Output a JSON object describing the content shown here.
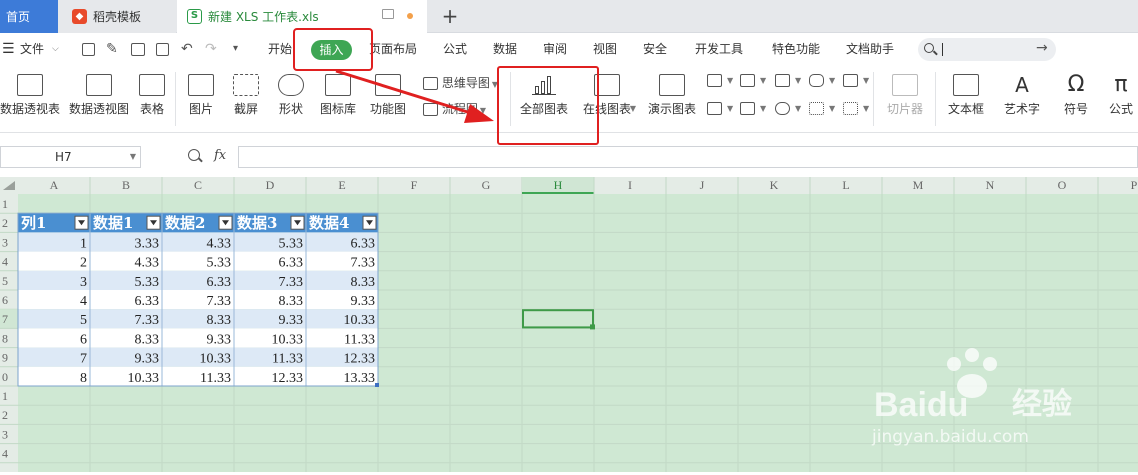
{
  "tabs": {
    "home": "首页",
    "templates": "稻壳模板",
    "templates_icon": "docer-icon",
    "doc": "新建 XLS 工作表.xls",
    "new": "+"
  },
  "menu": {
    "file": "文件",
    "items": [
      "开始",
      "插入",
      "页面布局",
      "公式",
      "数据",
      "审阅",
      "视图",
      "安全",
      "开发工具",
      "特色功能",
      "文档助手"
    ],
    "active": "插入"
  },
  "ribbon": {
    "large": [
      "数据透视表",
      "数据透视图",
      "表格",
      "图片",
      "截屏",
      "形状",
      "图标库",
      "功能图",
      "全部图表",
      "在线图表",
      "演示图表",
      "切片器",
      "文本框",
      "艺术字",
      "符号",
      "公式"
    ],
    "small": [
      "思维导图",
      "流程图"
    ]
  },
  "formula": {
    "cell": "H7",
    "fx": "fx",
    "value": ""
  },
  "sheet": {
    "columns": [
      "A",
      "B",
      "C",
      "D",
      "E",
      "F",
      "G",
      "H",
      "I",
      "J",
      "K",
      "L",
      "M",
      "N",
      "O",
      "P"
    ],
    "rows": [
      "1",
      "2",
      "3",
      "4",
      "5",
      "6",
      "7",
      "8",
      "9",
      "0",
      "1",
      "2",
      "3",
      "4"
    ],
    "selected_col": "H",
    "selected_row": "7",
    "header": [
      "列1",
      "数据1",
      "数据2",
      "数据3",
      "数据4"
    ],
    "data": [
      [
        "1",
        "3.33",
        "4.33",
        "5.33",
        "6.33"
      ],
      [
        "2",
        "4.33",
        "5.33",
        "6.33",
        "7.33"
      ],
      [
        "3",
        "5.33",
        "6.33",
        "7.33",
        "8.33"
      ],
      [
        "4",
        "6.33",
        "7.33",
        "8.33",
        "9.33"
      ],
      [
        "5",
        "7.33",
        "8.33",
        "9.33",
        "10.33"
      ],
      [
        "6",
        "8.33",
        "9.33",
        "10.33",
        "11.33"
      ],
      [
        "7",
        "9.33",
        "10.33",
        "11.33",
        "12.33"
      ],
      [
        "8",
        "10.33",
        "11.33",
        "12.33",
        "13.33"
      ]
    ]
  },
  "watermark": {
    "brand": "Baidu",
    "brand2": "经验",
    "url": "jingyan.baidu.com"
  },
  "colors": {
    "grid_bg": "#cfe8d3",
    "header_blue": "#4a8fd1",
    "band_light": "#dde9f6",
    "band_white": "#ffffff",
    "annotation_red": "#e02020",
    "accent_green": "#3ea654"
  }
}
